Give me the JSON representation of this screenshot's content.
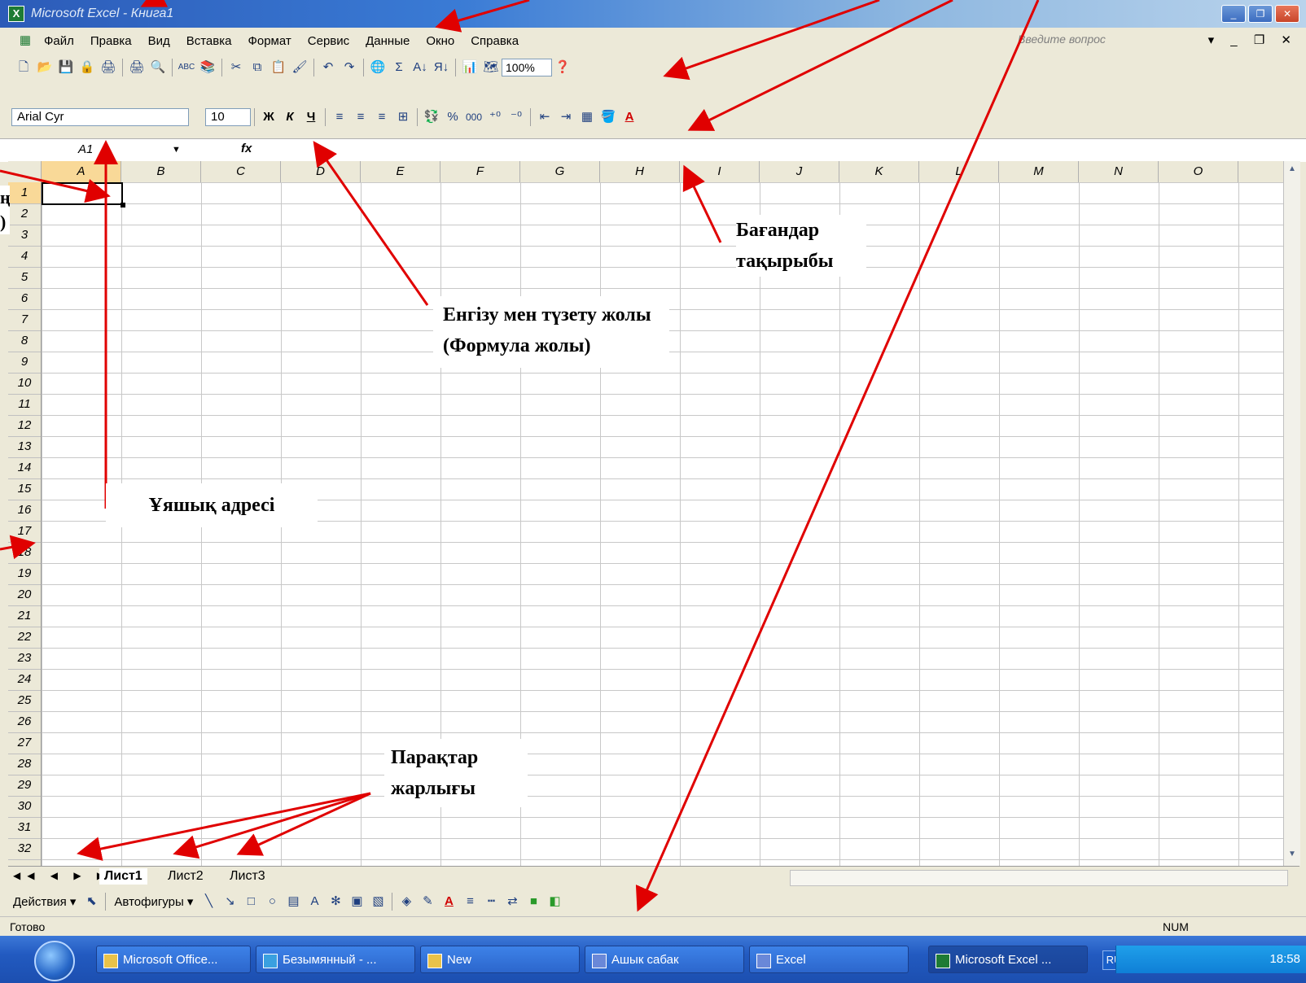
{
  "window": {
    "title": "Microsoft Excel - Книга1",
    "buttons": [
      "_",
      "❐",
      "✕"
    ]
  },
  "menu": {
    "items": [
      "Файл",
      "Правка",
      "Вид",
      "Вставка",
      "Формат",
      "Сервис",
      "Данные",
      "Окно",
      "Справка"
    ],
    "ask_placeholder": "Введите вопрос",
    "doc_buttons": "▾ _ ❐ ✕"
  },
  "toolbar_standard": {
    "buttons": [
      "🗋",
      "📂",
      "💾",
      "🔒",
      "🖨",
      "🖨",
      "🔍",
      "ABC",
      "📚",
      "✂",
      "⧉",
      "📋",
      "🖌",
      "↶",
      "↷",
      "🌐",
      "Σ",
      "A↓",
      "Я↓",
      "📊",
      "🗺"
    ],
    "zoom": "100%"
  },
  "toolbar_format": {
    "font": "Arial Cyr",
    "size": "10",
    "buttons": [
      "Ж",
      "К",
      "Ч",
      "≡",
      "≡",
      "≡",
      "⊞",
      "💱",
      "%",
      "000",
      "⁺⁰",
      "⁻⁰",
      "⇤",
      "⇥",
      "▦",
      "🪣",
      "A"
    ]
  },
  "formula_bar": {
    "name_box": "A1",
    "fx": "fx"
  },
  "grid": {
    "columns": [
      "A",
      "B",
      "C",
      "D",
      "E",
      "F",
      "G",
      "H",
      "I",
      "J",
      "K",
      "L",
      "M",
      "N",
      "O"
    ],
    "rows": [
      "1",
      "2",
      "3",
      "4",
      "5",
      "6",
      "7",
      "8",
      "9",
      "10",
      "11",
      "12",
      "13",
      "14",
      "15",
      "16",
      "17",
      "18",
      "19",
      "20",
      "21",
      "22",
      "23",
      "24",
      "25",
      "26",
      "27",
      "28",
      "29",
      "30",
      "31",
      "32"
    ]
  },
  "sheets": {
    "tabs": [
      "Лист1",
      "Лист2",
      "Лист3"
    ],
    "active": "Лист1",
    "nav": "◀◀ ◀ ▶ ▶▶"
  },
  "drawing_toolbar": {
    "actions": "Действия ▾",
    "autoshapes": "Автофигуры ▾"
  },
  "status": {
    "ready": "Готово",
    "num": "NUM"
  },
  "taskbar": {
    "items": [
      "Microsoft Office...",
      "Безымянный - ...",
      "New",
      "Ашык сабак",
      "Excel",
      "Microsoft Excel ..."
    ],
    "lang": "RU",
    "clock": "18:58"
  },
  "annotations": {
    "columns_header": "Бағандар тақырыбы",
    "formula_bar": "Енгізу мен түзету жолы (Формула жолы)",
    "cell_address": "Ұяшық адресі",
    "sheet_tabs": "Парақтар жарлығы",
    "left_partial": "ң )"
  },
  "colors": {
    "arrow": "#e00000",
    "title_start": "#2c5bb8",
    "taskbar": "#225ac0"
  }
}
